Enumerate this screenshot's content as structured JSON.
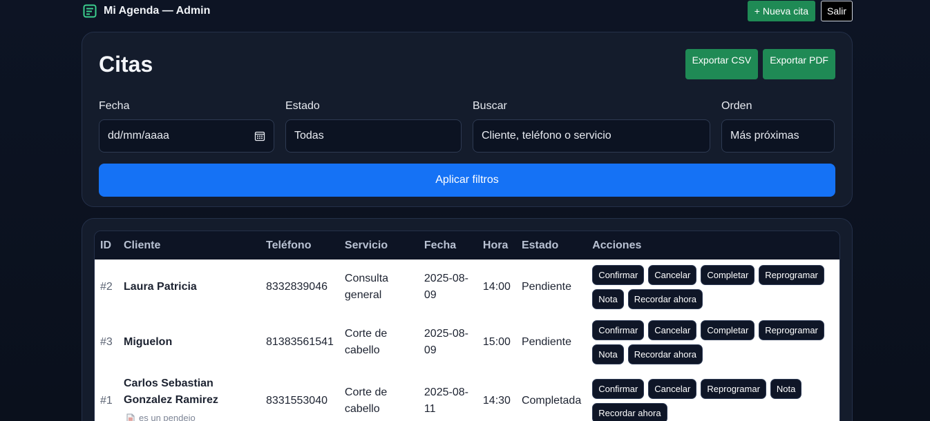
{
  "app": {
    "title": "Mi Agenda — Admin",
    "icon": "calendar-list-icon",
    "accent": "#1572f5",
    "green": "#1f8a55"
  },
  "topbar": {
    "new_label": "+ Nueva cita",
    "exit_label": "Salir"
  },
  "filters": {
    "title": "Citas",
    "export_csv": "Exportar CSV",
    "export_pdf": "Exportar PDF",
    "fecha": {
      "label": "Fecha",
      "value": "dd/mm/aaaa",
      "icon": "calendar-icon"
    },
    "estado": {
      "label": "Estado",
      "value": "Todas"
    },
    "buscar": {
      "label": "Buscar",
      "placeholder": "Cliente, teléfono o servicio"
    },
    "orden": {
      "label": "Orden",
      "value": "Más próximas"
    },
    "apply_label": "Aplicar filtros"
  },
  "table": {
    "headers": {
      "id": "ID",
      "cliente": "Cliente",
      "telefono": "Teléfono",
      "servicio": "Servicio",
      "fecha": "Fecha",
      "hora": "Hora",
      "estado": "Estado",
      "acciones": "Acciones"
    },
    "rows": [
      {
        "id": "#2",
        "cliente": "Laura Patricia",
        "telefono": "8332839046",
        "servicio": "Consulta general",
        "fecha": "2025-08-09",
        "hora": "14:00",
        "estado": "Pendiente",
        "actions": [
          "Confirmar",
          "Cancelar",
          "Completar",
          "Reprogramar",
          "Nota",
          "Recordar ahora"
        ]
      },
      {
        "id": "#3",
        "cliente": "Miguelon",
        "telefono": "81383561541",
        "servicio": "Corte de cabello",
        "fecha": "2025-08-09",
        "hora": "15:00",
        "estado": "Pendiente",
        "actions": [
          "Confirmar",
          "Cancelar",
          "Completar",
          "Reprogramar",
          "Nota",
          "Recordar ahora"
        ]
      },
      {
        "id": "#1",
        "cliente": "Carlos Sebastian Gonzalez Ramirez",
        "telefono": "8331553040",
        "servicio": "Corte de cabello",
        "fecha": "2025-08-11",
        "hora": "14:30",
        "estado": "Completada",
        "note": "es un pendejo",
        "note_icon": "note-icon",
        "actions": [
          "Confirmar",
          "Cancelar",
          "Reprogramar",
          "Nota",
          "Recordar ahora"
        ]
      }
    ]
  }
}
